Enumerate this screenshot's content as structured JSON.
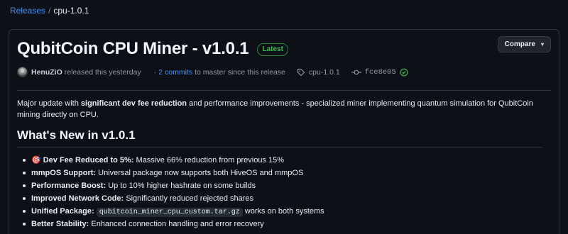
{
  "breadcrumb": {
    "releases": "Releases",
    "separator": "/",
    "current": "cpu-1.0.1"
  },
  "release": {
    "title": "QubitCoin CPU Miner - v1.0.1",
    "badge": "Latest",
    "compare_label": "Compare",
    "author": "HenuZiO",
    "released_text": "released this yesterday",
    "dot": "·",
    "commits_link": "2 commits",
    "commits_suffix": "to master since this release",
    "tag": "cpu-1.0.1",
    "commit_hash": "fce8e05"
  },
  "body": {
    "intro_pre": "Major update with ",
    "intro_bold": "significant dev fee reduction",
    "intro_post": " and performance improvements - specialized miner implementing quantum simulation for QubitCoin mining directly on CPU.",
    "heading": "What's New in v1.0.1",
    "features": [
      {
        "emoji": "🎯",
        "title": "Dev Fee Reduced to 5%:",
        "text": " Massive 66% reduction from previous 15%"
      },
      {
        "title": "mmpOS Support:",
        "text": " Universal package now supports both HiveOS and mmpOS"
      },
      {
        "title": "Performance Boost:",
        "text": " Up to 10% higher hashrate on some builds"
      },
      {
        "title": "Improved Network Code:",
        "text": " Significantly reduced rejected shares"
      },
      {
        "title": "Unified Package:",
        "code": "qubitcoin_miner_cpu_custom.tar.gz",
        "text": " works on both systems"
      },
      {
        "title": "Better Stability:",
        "text": " Enhanced connection handling and error recovery"
      }
    ]
  },
  "colors": {
    "link": "#4493f8",
    "latest_green": "#3fb950",
    "background": "#0d1117",
    "border": "#30363d"
  }
}
